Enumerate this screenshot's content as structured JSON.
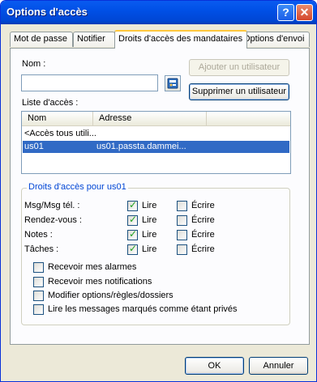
{
  "window": {
    "title": "Options d'accès",
    "help_glyph": "?",
    "close_glyph": "✕"
  },
  "tabs": [
    {
      "label": "Mot de passe"
    },
    {
      "label": "Notifier"
    },
    {
      "label": "Droits d'accès des mandataires"
    },
    {
      "label": "Options d'envoi"
    }
  ],
  "name_section": {
    "label": "Nom :",
    "value": ""
  },
  "buttons": {
    "add_user": "Ajouter un utilisateur",
    "remove_user": "Supprimer un utilisateur",
    "ok": "OK",
    "cancel": "Annuler"
  },
  "access_list": {
    "label": "Liste d'accès :",
    "columns": [
      "Nom",
      "Adresse"
    ],
    "rows": [
      {
        "name": "<Accès tous utili...",
        "address": ""
      },
      {
        "name": "us01",
        "address": "us01.passta.dammei..."
      }
    ]
  },
  "rights": {
    "title": "Droits d'accès pour us01",
    "rows": [
      {
        "label": "Msg/Msg tél. :",
        "read": true,
        "write": false
      },
      {
        "label": "Rendez-vous :",
        "read": true,
        "write": false
      },
      {
        "label": "Notes :",
        "read": true,
        "write": false
      },
      {
        "label": "Tâches :",
        "read": true,
        "write": false
      }
    ],
    "read_label": "Lire",
    "write_label": "Écrire",
    "options": [
      {
        "label": "Recevoir mes alarmes",
        "checked": false
      },
      {
        "label": "Recevoir mes notifications",
        "checked": false
      },
      {
        "label": "Modifier options/règles/dossiers",
        "checked": false
      },
      {
        "label": "Lire les messages marqués comme étant privés",
        "checked": false
      }
    ]
  }
}
